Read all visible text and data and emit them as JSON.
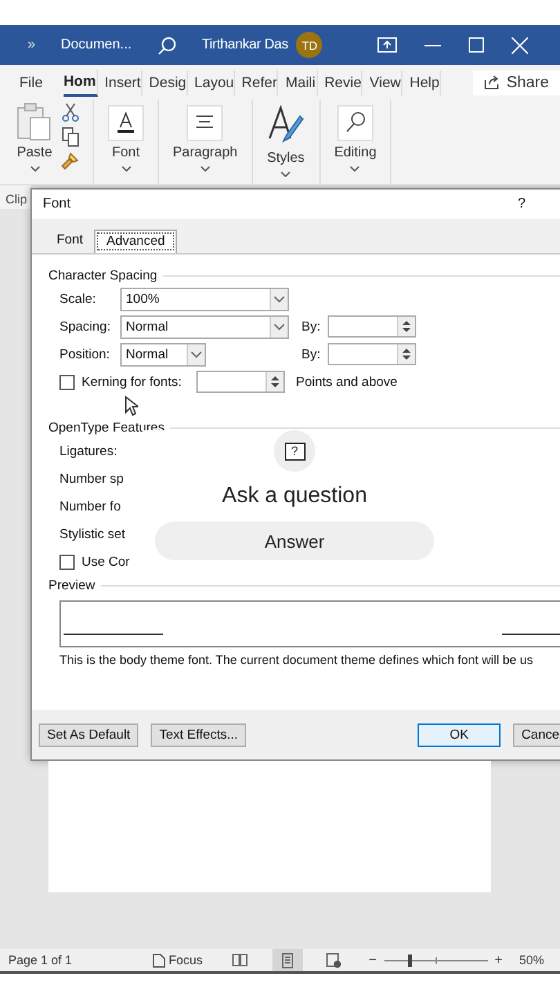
{
  "title_bar": {
    "more": "»",
    "document": "Documen...",
    "user": "Tirthankar Das",
    "avatar": "TD"
  },
  "ribbon_tabs": [
    {
      "label": "File",
      "selected": false
    },
    {
      "label": "Hom",
      "selected": true
    },
    {
      "label": "Insert",
      "selected": false
    },
    {
      "label": "Desig",
      "selected": false
    },
    {
      "label": "Layou",
      "selected": false
    },
    {
      "label": "Refer",
      "selected": false
    },
    {
      "label": "Maili",
      "selected": false
    },
    {
      "label": "Revie",
      "selected": false
    },
    {
      "label": "View",
      "selected": false
    },
    {
      "label": "Help",
      "selected": false
    }
  ],
  "share": "Share",
  "ribbon_groups": [
    {
      "kind": "paste",
      "label": "Paste"
    },
    {
      "kind": "font",
      "label": "Font"
    },
    {
      "kind": "paragraph",
      "label": "Paragraph"
    },
    {
      "kind": "styles",
      "label": "Styles"
    },
    {
      "kind": "editing",
      "label": "Editing"
    }
  ],
  "clipboard_label": "Clip",
  "dialog": {
    "title": "Font",
    "help": "?",
    "tabs": [
      {
        "label": "Font",
        "selected": false
      },
      {
        "label": "Advanced",
        "selected": true
      }
    ],
    "character_spacing": {
      "heading": "Character Spacing",
      "scale": {
        "label": "Scale:",
        "value": "100%"
      },
      "spacing": {
        "label": "Spacing:",
        "value": "Normal",
        "by_label": "By:"
      },
      "position": {
        "label": "Position:",
        "value": "Normal",
        "by_label": "By:"
      },
      "kerning": {
        "label": "Kerning for fonts:",
        "checked": false,
        "suffix": "Points and above"
      }
    },
    "opentype": {
      "heading": "OpenType Features",
      "labels": [
        "Ligatures:",
        "Number sp",
        "Number fo",
        "Stylistic set"
      ],
      "contextual": {
        "label": "Use Cor",
        "checked": false
      }
    },
    "preview": {
      "heading": "Preview",
      "description": "This is the body theme font. The current document theme defines which font will be us"
    },
    "buttons": [
      {
        "label": "Set As Default",
        "default": false
      },
      {
        "label": "Text Effects...",
        "default": false
      },
      {
        "label": "OK",
        "default": true
      },
      {
        "label": "Cance",
        "default": false
      }
    ]
  },
  "overlay": {
    "icon": "?",
    "title": "Ask a question",
    "button": "Answer"
  },
  "status_bar": {
    "page": "Page 1 of 1",
    "focus": "Focus",
    "views": [
      {
        "kind": "read",
        "selected": false
      },
      {
        "kind": "print",
        "selected": true
      },
      {
        "kind": "web",
        "selected": false
      }
    ],
    "minus": "−",
    "plus": "+",
    "zoom": {
      "level": 0.25
    },
    "zoom_label": "50%"
  }
}
